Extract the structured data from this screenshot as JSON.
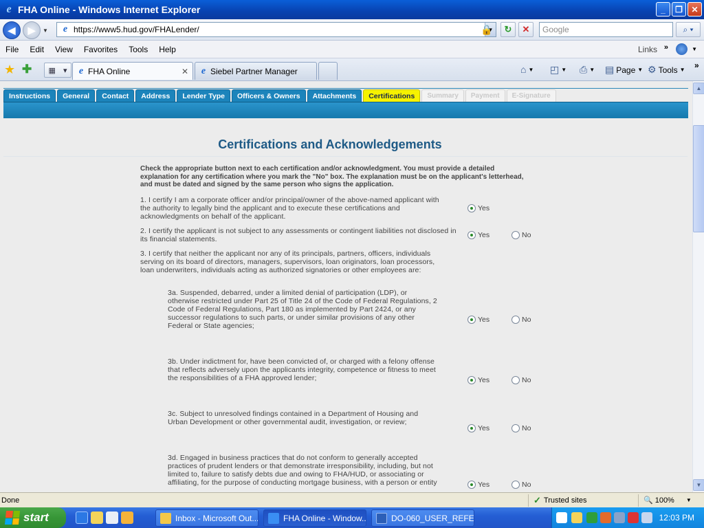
{
  "window": {
    "title": "FHA Online - Windows Internet Explorer"
  },
  "addressbar": {
    "url": "https://www5.hud.gov/FHALender/",
    "search_placeholder": "Google"
  },
  "menubar": {
    "items": [
      "File",
      "Edit",
      "View",
      "Favorites",
      "Tools",
      "Help"
    ],
    "links": "Links"
  },
  "browser_tabs": [
    {
      "label": "FHA Online",
      "active": true
    },
    {
      "label": "Siebel Partner Manager",
      "active": false
    }
  ],
  "commandbar": {
    "page": "Page",
    "tools": "Tools"
  },
  "app_tabs": [
    {
      "label": "Instructions",
      "state": "normal"
    },
    {
      "label": "General",
      "state": "normal"
    },
    {
      "label": "Contact",
      "state": "normal"
    },
    {
      "label": "Address",
      "state": "normal"
    },
    {
      "label": "Lender Type",
      "state": "normal"
    },
    {
      "label": "Officers & Owners",
      "state": "normal"
    },
    {
      "label": "Attachments",
      "state": "normal"
    },
    {
      "label": "Certifications",
      "state": "current"
    },
    {
      "label": "Summary",
      "state": "disabled"
    },
    {
      "label": "Payment",
      "state": "disabled"
    },
    {
      "label": "E-Signature",
      "state": "disabled"
    }
  ],
  "page": {
    "title": "Certifications and Acknowledgements",
    "intro": "Check the appropriate button next to each certification and/or acknowledgment. You must provide a detailed explanation for any certification where you mark the \"No\" box. The explanation must be on the applicant's letterhead, and must be dated and signed by the same person who signs the application.",
    "yes_label": "Yes",
    "no_label": "No",
    "items": [
      {
        "text": "1. I certify I am a corporate officer and/or principal/owner of the above-named applicant with the authority to legally bind the applicant and to execute these certifications and acknowledgments on behalf of the applicant.",
        "selected": "Yes",
        "has_no": false
      },
      {
        "text": "2. I certify the applicant is not subject to any assessments or contingent liabilities not disclosed in its financial statements.",
        "selected": "Yes",
        "has_no": true
      },
      {
        "text": "3. I certify that neither the applicant nor any of its principals, partners, officers, individuals serving on its board of directors, managers, supervisors, loan originators, loan processors, loan underwriters, individuals acting as authorized signatories or other employees are:"
      },
      {
        "text": "3a. Suspended, debarred, under a limited denial of participation (LDP), or otherwise restricted under Part 25 of Title 24 of the Code of Federal Regulations, 2 Code of Federal Regulations, Part 180 as implemented by Part 2424, or any successor regulations to such parts, or under similar provisions of any other Federal or State agencies;",
        "selected": "Yes",
        "has_no": true
      },
      {
        "text": "3b. Under indictment for, have been convicted of, or charged with a felony offense that reflects adversely upon the applicants integrity, competence or fitness to meet the responsibilities of a FHA approved lender;",
        "selected": "Yes",
        "has_no": true
      },
      {
        "text": "3c. Subject to unresolved findings contained in a Department of Housing and Urban Development or other governmental audit, investigation, or review;",
        "selected": "Yes",
        "has_no": true
      },
      {
        "text": "3d. Engaged in business practices that do not conform to generally accepted practices of prudent lenders or that demonstrate irresponsibility, including, but not limited to, failure to satisfy debts due and owing to FHA/HUD, or associating or affiliating, for the purpose of conducting mortgage business, with a person or entity",
        "selected": "Yes",
        "has_no": true
      }
    ]
  },
  "statusbar": {
    "status": "Done",
    "zone": "Trusted sites",
    "zoom": "100%"
  },
  "taskbar": {
    "start": "start",
    "items": [
      {
        "label": "Inbox - Microsoft Out...",
        "active": false
      },
      {
        "label": "FHA Online - Window...",
        "active": true
      },
      {
        "label": "DO-060_USER_REFE...",
        "active": false
      }
    ],
    "clock": "12:03 PM"
  }
}
